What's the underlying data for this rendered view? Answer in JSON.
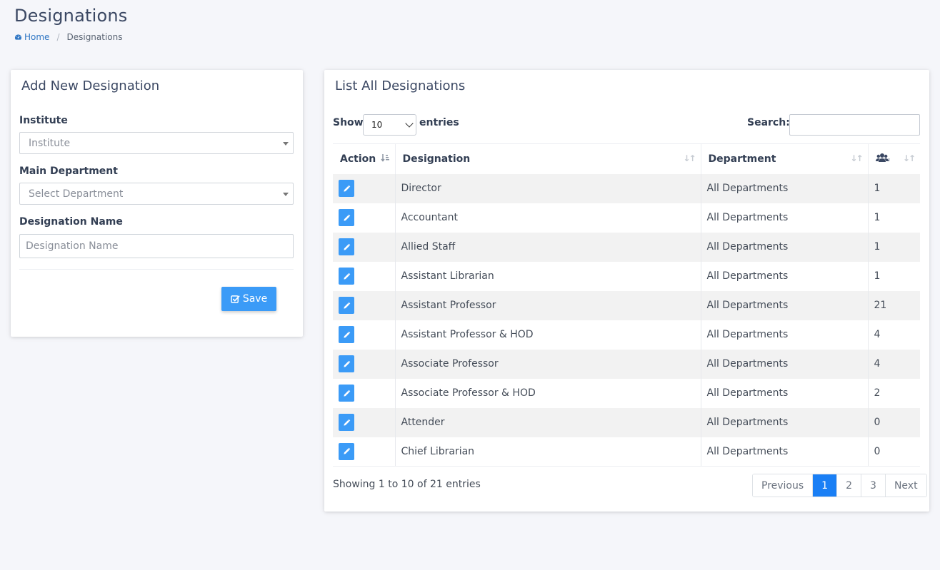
{
  "page": {
    "title": "Designations",
    "breadcrumb": {
      "home": "Home",
      "current": "Designations"
    }
  },
  "form": {
    "title": "Add New Designation",
    "institute": {
      "label": "Institute",
      "placeholder": "Institute"
    },
    "department": {
      "label": "Main Department",
      "placeholder": "Select Department"
    },
    "designation": {
      "label": "Designation Name",
      "placeholder": "Designation Name"
    },
    "save_label": "Save"
  },
  "list": {
    "title": "List All  Designations",
    "show_label": "Show",
    "page_length": "10",
    "entries_label": "entries",
    "search_label": "Search:",
    "columns": {
      "action": "Action",
      "designation": "Designation",
      "department": "Department",
      "count_icon": "users-icon"
    },
    "rows": [
      {
        "designation": "Director",
        "department": "All Departments",
        "count": "1"
      },
      {
        "designation": "Accountant",
        "department": "All Departments",
        "count": "1"
      },
      {
        "designation": "Allied Staff",
        "department": "All Departments",
        "count": "1"
      },
      {
        "designation": "Assistant Librarian",
        "department": "All Departments",
        "count": "1"
      },
      {
        "designation": "Assistant Professor",
        "department": "All Departments",
        "count": "21"
      },
      {
        "designation": "Assistant Professor & HOD",
        "department": "All Departments",
        "count": "4"
      },
      {
        "designation": "Associate Professor",
        "department": "All Departments",
        "count": "4"
      },
      {
        "designation": "Associate Professor & HOD",
        "department": "All Departments",
        "count": "2"
      },
      {
        "designation": "Attender",
        "department": "All Departments",
        "count": "0"
      },
      {
        "designation": "Chief Librarian",
        "department": "All Departments",
        "count": "0"
      }
    ],
    "info": "Showing 1 to 10 of 21 entries",
    "pagination": {
      "previous": "Previous",
      "pages": [
        "1",
        "2",
        "3"
      ],
      "active": "1",
      "next": "Next"
    }
  },
  "colors": {
    "accent": "#3b9bf7",
    "active_page": "#1a7ff5",
    "link": "#2f76c4"
  }
}
